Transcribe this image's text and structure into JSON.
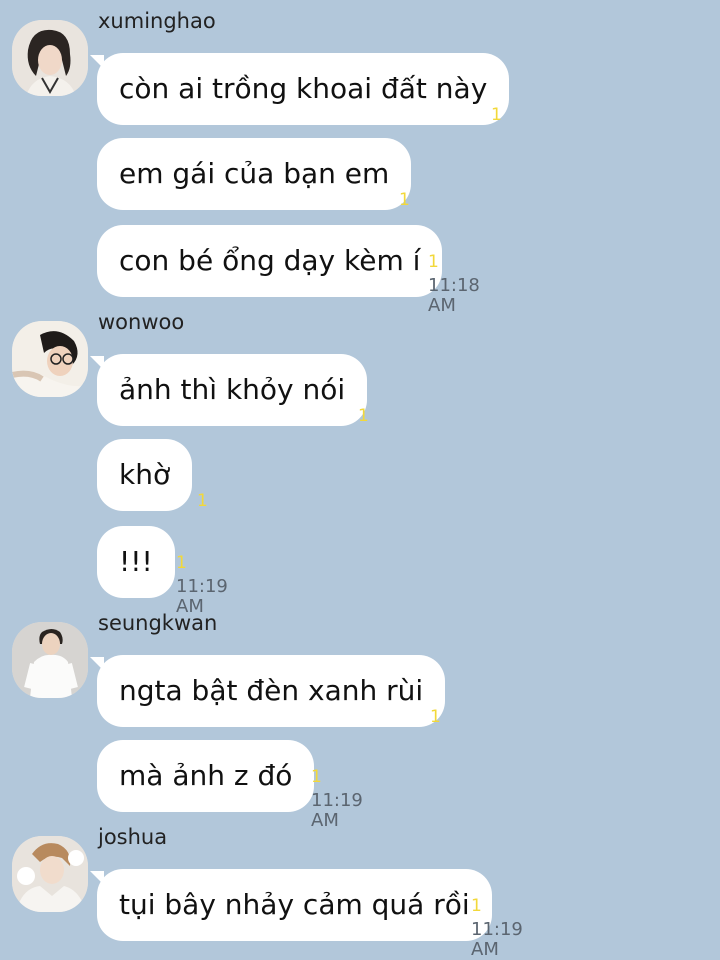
{
  "groups": [
    {
      "sender": "xuminghao",
      "avatar_icon": "profile-photo-icon",
      "messages": [
        {
          "text": "còn ai trồng khoai đất này",
          "unread": "1",
          "time": ""
        },
        {
          "text": "em gái của bạn em",
          "unread": "1",
          "time": ""
        },
        {
          "text": "con bé ổng dạy kèm í",
          "unread": "1",
          "time": "11:18 AM"
        }
      ]
    },
    {
      "sender": "wonwoo",
      "avatar_icon": "profile-photo-icon",
      "messages": [
        {
          "text": "ảnh thì khỏy nói",
          "unread": "1",
          "time": ""
        },
        {
          "text": "khờ",
          "unread": "1",
          "time": ""
        },
        {
          "text": "!!!",
          "unread": "1",
          "time": "11:19 AM"
        }
      ]
    },
    {
      "sender": "seungkwan",
      "avatar_icon": "profile-photo-icon",
      "messages": [
        {
          "text": "ngta bật đèn xanh rùi",
          "unread": "1",
          "time": ""
        },
        {
          "text": "mà ảnh z đó",
          "unread": "1",
          "time": "11:19 AM"
        }
      ]
    },
    {
      "sender": "joshua",
      "avatar_icon": "profile-photo-icon",
      "messages": [
        {
          "text": "tụi bây nhảy cảm quá rồi",
          "unread": "1",
          "time": "11:19 AM"
        }
      ]
    }
  ],
  "colors": {
    "background": "#b2c7da",
    "bubble": "#ffffff",
    "unread": "#f2d83a",
    "time": "#5b6570"
  }
}
